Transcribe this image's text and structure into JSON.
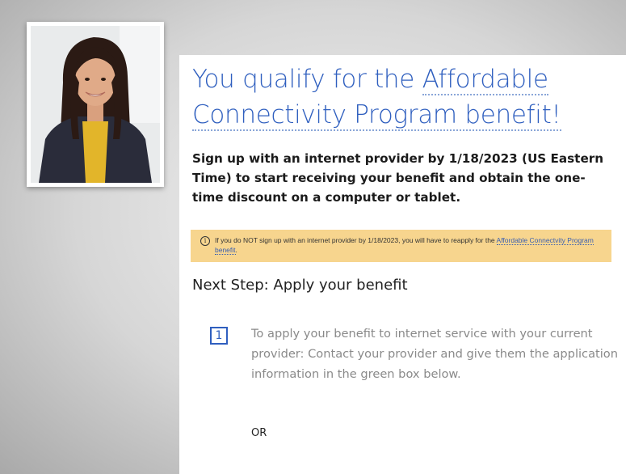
{
  "presenter": {
    "photo_alt": "presenter"
  },
  "card": {
    "title_part1": "You qualify for the ",
    "title_link": "Affordable",
    "title_line2": "Connectivity Program benefit!",
    "lead": "Sign up with an internet provider by 1/18/2023 (US Eastern Time) to start receiving your benefit and obtain the one-time discount on a computer or tablet.",
    "alert": {
      "icon_glyph": "i",
      "text": "If you do NOT sign up with an internet provider by 1/18/2023, you will have to reapply for the ",
      "link": "Affordable Connectvity Program benefit",
      "tail": ".",
      "background": "#f7d58e"
    },
    "next_step": "Next Step: Apply your benefit",
    "step": {
      "number": "1",
      "text": "To apply your benefit to internet service with your current provider: Contact your provider and give them the application information in the green box below."
    },
    "or_text": "OR",
    "accent_color": "#2f5fbf"
  }
}
